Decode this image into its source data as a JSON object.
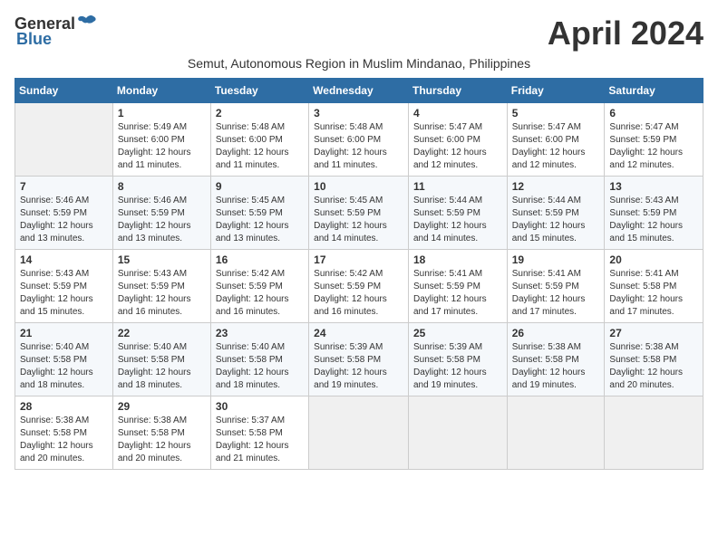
{
  "header": {
    "logo_general": "General",
    "logo_blue": "Blue",
    "month_title": "April 2024",
    "subtitle": "Semut, Autonomous Region in Muslim Mindanao, Philippines"
  },
  "days_of_week": [
    "Sunday",
    "Monday",
    "Tuesday",
    "Wednesday",
    "Thursday",
    "Friday",
    "Saturday"
  ],
  "weeks": [
    [
      {
        "day": "",
        "info": ""
      },
      {
        "day": "1",
        "info": "Sunrise: 5:49 AM\nSunset: 6:00 PM\nDaylight: 12 hours\nand 11 minutes."
      },
      {
        "day": "2",
        "info": "Sunrise: 5:48 AM\nSunset: 6:00 PM\nDaylight: 12 hours\nand 11 minutes."
      },
      {
        "day": "3",
        "info": "Sunrise: 5:48 AM\nSunset: 6:00 PM\nDaylight: 12 hours\nand 11 minutes."
      },
      {
        "day": "4",
        "info": "Sunrise: 5:47 AM\nSunset: 6:00 PM\nDaylight: 12 hours\nand 12 minutes."
      },
      {
        "day": "5",
        "info": "Sunrise: 5:47 AM\nSunset: 6:00 PM\nDaylight: 12 hours\nand 12 minutes."
      },
      {
        "day": "6",
        "info": "Sunrise: 5:47 AM\nSunset: 5:59 PM\nDaylight: 12 hours\nand 12 minutes."
      }
    ],
    [
      {
        "day": "7",
        "info": "Sunrise: 5:46 AM\nSunset: 5:59 PM\nDaylight: 12 hours\nand 13 minutes."
      },
      {
        "day": "8",
        "info": "Sunrise: 5:46 AM\nSunset: 5:59 PM\nDaylight: 12 hours\nand 13 minutes."
      },
      {
        "day": "9",
        "info": "Sunrise: 5:45 AM\nSunset: 5:59 PM\nDaylight: 12 hours\nand 13 minutes."
      },
      {
        "day": "10",
        "info": "Sunrise: 5:45 AM\nSunset: 5:59 PM\nDaylight: 12 hours\nand 14 minutes."
      },
      {
        "day": "11",
        "info": "Sunrise: 5:44 AM\nSunset: 5:59 PM\nDaylight: 12 hours\nand 14 minutes."
      },
      {
        "day": "12",
        "info": "Sunrise: 5:44 AM\nSunset: 5:59 PM\nDaylight: 12 hours\nand 15 minutes."
      },
      {
        "day": "13",
        "info": "Sunrise: 5:43 AM\nSunset: 5:59 PM\nDaylight: 12 hours\nand 15 minutes."
      }
    ],
    [
      {
        "day": "14",
        "info": "Sunrise: 5:43 AM\nSunset: 5:59 PM\nDaylight: 12 hours\nand 15 minutes."
      },
      {
        "day": "15",
        "info": "Sunrise: 5:43 AM\nSunset: 5:59 PM\nDaylight: 12 hours\nand 16 minutes."
      },
      {
        "day": "16",
        "info": "Sunrise: 5:42 AM\nSunset: 5:59 PM\nDaylight: 12 hours\nand 16 minutes."
      },
      {
        "day": "17",
        "info": "Sunrise: 5:42 AM\nSunset: 5:59 PM\nDaylight: 12 hours\nand 16 minutes."
      },
      {
        "day": "18",
        "info": "Sunrise: 5:41 AM\nSunset: 5:59 PM\nDaylight: 12 hours\nand 17 minutes."
      },
      {
        "day": "19",
        "info": "Sunrise: 5:41 AM\nSunset: 5:59 PM\nDaylight: 12 hours\nand 17 minutes."
      },
      {
        "day": "20",
        "info": "Sunrise: 5:41 AM\nSunset: 5:58 PM\nDaylight: 12 hours\nand 17 minutes."
      }
    ],
    [
      {
        "day": "21",
        "info": "Sunrise: 5:40 AM\nSunset: 5:58 PM\nDaylight: 12 hours\nand 18 minutes."
      },
      {
        "day": "22",
        "info": "Sunrise: 5:40 AM\nSunset: 5:58 PM\nDaylight: 12 hours\nand 18 minutes."
      },
      {
        "day": "23",
        "info": "Sunrise: 5:40 AM\nSunset: 5:58 PM\nDaylight: 12 hours\nand 18 minutes."
      },
      {
        "day": "24",
        "info": "Sunrise: 5:39 AM\nSunset: 5:58 PM\nDaylight: 12 hours\nand 19 minutes."
      },
      {
        "day": "25",
        "info": "Sunrise: 5:39 AM\nSunset: 5:58 PM\nDaylight: 12 hours\nand 19 minutes."
      },
      {
        "day": "26",
        "info": "Sunrise: 5:38 AM\nSunset: 5:58 PM\nDaylight: 12 hours\nand 19 minutes."
      },
      {
        "day": "27",
        "info": "Sunrise: 5:38 AM\nSunset: 5:58 PM\nDaylight: 12 hours\nand 20 minutes."
      }
    ],
    [
      {
        "day": "28",
        "info": "Sunrise: 5:38 AM\nSunset: 5:58 PM\nDaylight: 12 hours\nand 20 minutes."
      },
      {
        "day": "29",
        "info": "Sunrise: 5:38 AM\nSunset: 5:58 PM\nDaylight: 12 hours\nand 20 minutes."
      },
      {
        "day": "30",
        "info": "Sunrise: 5:37 AM\nSunset: 5:58 PM\nDaylight: 12 hours\nand 21 minutes."
      },
      {
        "day": "",
        "info": ""
      },
      {
        "day": "",
        "info": ""
      },
      {
        "day": "",
        "info": ""
      },
      {
        "day": "",
        "info": ""
      }
    ]
  ]
}
